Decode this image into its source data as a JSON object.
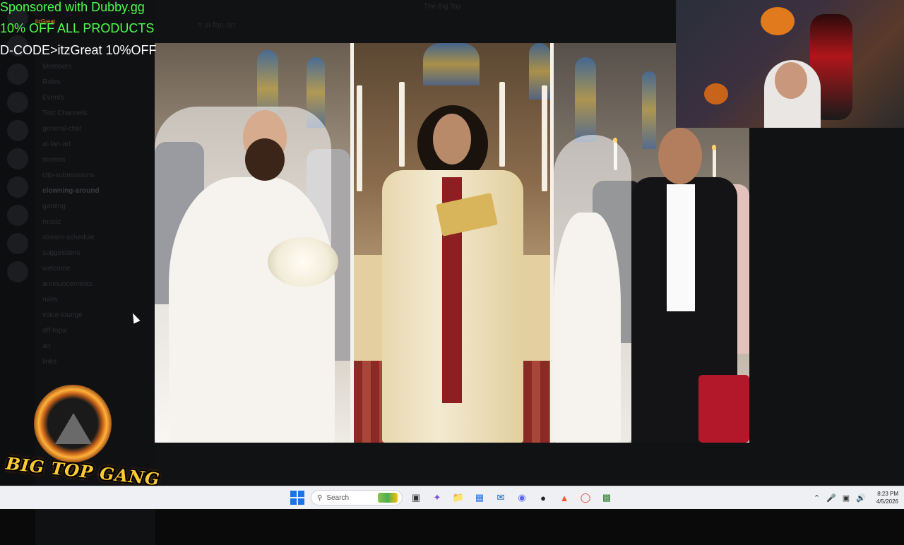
{
  "background": {
    "window_title": "The Big Top",
    "tab_label": "# ai-fan-art",
    "channels": [
      "Members",
      "Roles",
      "Events",
      "Text Channels",
      "general-chat",
      "ai-fan-art",
      "memes",
      "clip-submissions",
      "clowning-around",
      "gaming",
      "music",
      "stream-schedule",
      "suggestions",
      "welcome",
      "announcements",
      "rules",
      "voice-lounge",
      "off-topic",
      "art",
      "links"
    ],
    "active_channel": "clowning-around"
  },
  "overlay": {
    "sponsor_line": "Sponsored with Dubby.gg",
    "discount_line": "10% OFF ALL PRODUCTS",
    "code_line": "D-CODE>itzGreat 10%OFF",
    "small_label": "itzGreat"
  },
  "logo": {
    "text": "BIG TOP GANG"
  },
  "taskbar": {
    "search_placeholder": "Search",
    "time": "8:23 PM",
    "date": "4/5/2026",
    "icons": [
      "start-icon",
      "search-icon",
      "task-view-icon",
      "copilot-icon",
      "file-explorer-icon",
      "store-icon",
      "outlook-icon",
      "discord-icon",
      "obs-icon",
      "brave-icon",
      "chrome-icon",
      "terminal-icon"
    ],
    "tray_icons": [
      "chevron-up-icon",
      "microphone-icon",
      "network-icon",
      "volume-icon"
    ]
  }
}
